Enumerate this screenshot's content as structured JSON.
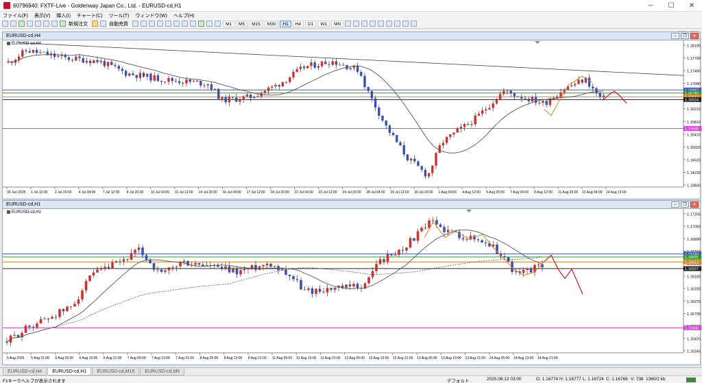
{
  "window": {
    "title": "60796940: FXTF-Live - Goldenway Japan Co., Ltd. - EURUSD-cd,H1",
    "minimize": "─",
    "maximize": "☐",
    "close": "✕"
  },
  "menu": [
    "ファイル(F)",
    "表示(V)",
    "挿入(I)",
    "チャート(C)",
    "ツール(T)",
    "ウィンドウ(W)",
    "ヘルプ(H)"
  ],
  "toolbar": {
    "new_order": "新規注文",
    "auto_trade": "自動売買",
    "timeframes": [
      "M1",
      "M5",
      "M15",
      "M30",
      "H1",
      "H4",
      "D1",
      "W1",
      "MN"
    ],
    "selected_tf": "H1"
  },
  "colors": {
    "bull": "#d03030",
    "bear": "#3a50b4",
    "magenta": "#e040e0",
    "ma": "#555555",
    "orange": "#e08020",
    "forecast": "#d41a1a",
    "blue_line": "#4455cc",
    "green_line": "#2a9a2a"
  },
  "chart_h4": {
    "title": "EURUSD-cd,H4",
    "label": "EURUSD-cd,H4",
    "y_ticks": [
      "1.18190",
      "1.17790",
      "1.17400",
      "1.17000",
      "1.16610",
      "1.16210",
      "1.15810",
      "1.15410",
      "1.15020",
      "1.14620",
      "1.14230",
      "1.13830"
    ],
    "y_range": [
      1.1363,
      1.1839
    ],
    "price_labels": [
      {
        "text": "1.16842",
        "value": 1.16842,
        "bg": "#4455cc"
      },
      {
        "text": "1.16740",
        "value": 1.1674,
        "bg": "#2a9a2a"
      },
      {
        "text": "1.16613",
        "value": 1.16613,
        "bg": "#e08020"
      },
      {
        "text": "1.16524",
        "value": 1.16524,
        "bg": "#222222"
      },
      {
        "text": "1.15568",
        "value": 1.15568,
        "bg": "#e040e0"
      }
    ],
    "x_ticks": [
      "30 Jun 2025",
      "1 Jul 12:00",
      "2 Jul 20:00",
      "4 Jul 04:00",
      "7 Jul 12:00",
      "8 Jul 20:00",
      "10 Jul 04:00",
      "11 Jul 12:00",
      "14 Jul 20:00",
      "16 Jul 04:00",
      "17 Jul 12:00",
      "18 Jul 20:00",
      "22 Jul 04:00",
      "23 Jul 12:00",
      "24 Jul 20:00",
      "28 Jul 04:00",
      "29 Jul 12:00",
      "30 Jul 20:00",
      "1 Aug 04:00",
      "4 Aug 12:00",
      "5 Aug 20:00",
      "7 Aug 04:00",
      "8 Aug 12:00",
      "11 Aug 20:00",
      "13 Aug 04:00",
      "14 Aug 12:00"
    ]
  },
  "chart_h1": {
    "title": "EURUSD-cd,H1",
    "label": "EURUSD-cd,H1",
    "y_ticks": [
      "1.17255",
      "1.17055",
      "1.16890",
      "1.16740",
      "1.16515",
      "1.16335",
      "1.16155",
      "1.15975",
      "1.15795",
      "1.15615",
      "1.15420",
      "1.15240"
    ],
    "y_range": [
      1.1517,
      1.1741
    ],
    "price_labels": [
      {
        "text": "1.16740",
        "value": 1.1674,
        "bg": "#4455cc"
      },
      {
        "text": "1.16692",
        "value": 1.16692,
        "bg": "#2a9a2a"
      },
      {
        "text": "1.16613",
        "value": 1.16613,
        "bg": "#e08020"
      },
      {
        "text": "1.16507",
        "value": 1.16507,
        "bg": "#222222"
      },
      {
        "text": "1.15568",
        "value": 1.15568,
        "bg": "#e040e0"
      }
    ],
    "x_ticks": [
      "5 Aug 2025",
      "5 Aug 21:00",
      "6 Aug 05:00",
      "6 Aug 13:00",
      "6 Aug 21:00",
      "7 Aug 05:00",
      "7 Aug 13:00",
      "7 Aug 21:00",
      "8 Aug 05:00",
      "8 Aug 13:00",
      "8 Aug 21:00",
      "11 Aug 05:00",
      "11 Aug 13:00",
      "11 Aug 21:00",
      "12 Aug 05:00",
      "12 Aug 13:00",
      "12 Aug 21:00",
      "13 Aug 05:00",
      "13 Aug 13:00",
      "13 Aug 21:00",
      "14 Aug 05:00",
      "14 Aug 13:00",
      "14 Aug 21:00"
    ]
  },
  "tabs": [
    "EURUSD-cd,H4",
    "EURUSD-cd,H1",
    "EURUSD-cd,M15",
    "EURUSD-cd,M5"
  ],
  "active_tab": 1,
  "status": {
    "help": "F1キーでヘルプが表示されます",
    "profile": "デフォルト",
    "time": "2025.08.13 03:00",
    "open": "O: 1.16774",
    "high": "H: 1.16777",
    "low": "L: 1.16724",
    "close": "C: 1.16766",
    "volume": "V: 738",
    "traffic": "1360/2 kb"
  }
}
